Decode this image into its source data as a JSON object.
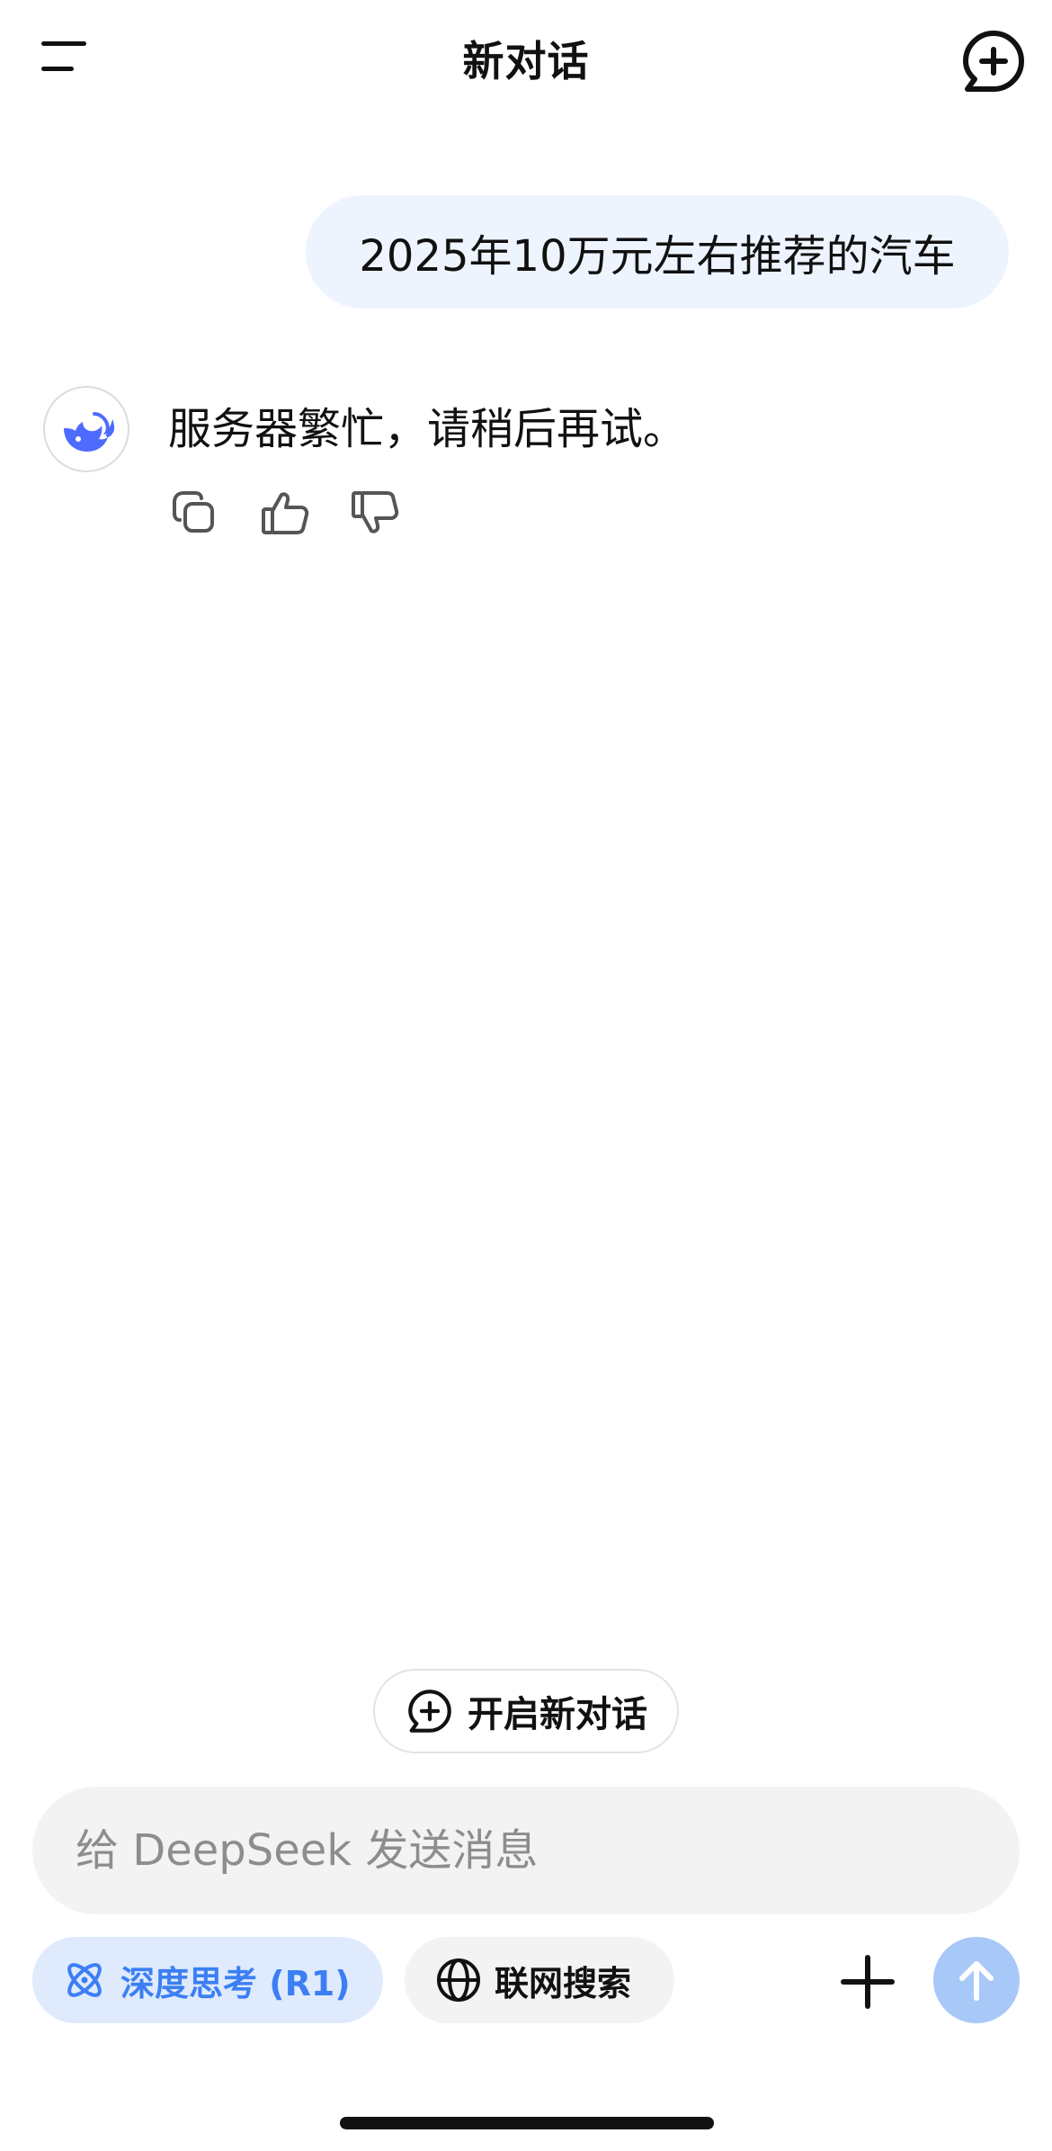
{
  "header": {
    "title": "新对话",
    "menu_icon": "menu-icon",
    "new_chat_icon": "chat-plus-icon"
  },
  "messages": {
    "user": {
      "text": "2025年10万元左右推荐的汽车"
    },
    "assistant": {
      "avatar_icon": "deepseek-whale-icon",
      "text": "服务器繁忙，请稍后再试。",
      "actions": [
        "copy-icon",
        "thumbs-up-icon",
        "thumbs-down-icon"
      ]
    }
  },
  "new_chat_pill": {
    "label": "开启新对话",
    "icon": "chat-plus-icon"
  },
  "input": {
    "placeholder": "给 DeepSeek 发送消息",
    "value": ""
  },
  "toolbar": {
    "deep_think_label": "深度思考 (R1)",
    "deep_think_icon": "atom-icon",
    "web_search_label": "联网搜索",
    "web_search_icon": "globe-icon",
    "plus_icon": "plus-icon",
    "send_icon": "arrow-up-icon"
  },
  "colors": {
    "accent": "#3c7ff4",
    "accent_bg": "#dfeafd",
    "user_bubble": "#eef4fe",
    "send_button": "#a8c8f8",
    "input_bg": "#f3f3f3"
  }
}
